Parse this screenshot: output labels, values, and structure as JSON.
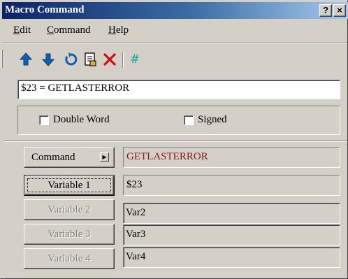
{
  "window": {
    "title": "Macro Command",
    "help_button": "?",
    "close_button": "×"
  },
  "menu": {
    "items": [
      {
        "label": "Edit",
        "mnemonic": "E",
        "rest": "dit"
      },
      {
        "label": "Command",
        "mnemonic": "C",
        "rest": "ommand"
      },
      {
        "label": "Help",
        "mnemonic": "H",
        "rest": "elp"
      }
    ]
  },
  "toolbar": {
    "icons": [
      "move-up-icon",
      "move-down-icon",
      "undo-icon",
      "properties-icon",
      "delete-icon",
      "number-icon"
    ],
    "hash_symbol": "#"
  },
  "colors": {
    "up_arrow": "#1060b0",
    "down_arrow": "#1060b0",
    "undo": "#1060b0",
    "delete": "#cc1010",
    "hash": "#10a0a0",
    "command_text": "#8b1a1a"
  },
  "expression": {
    "value": "$23 = GETLASTERROR"
  },
  "options": {
    "double_word": {
      "label": "Double Word",
      "checked": false
    },
    "signed": {
      "label": "Signed",
      "checked": false
    }
  },
  "command": {
    "button_label": "Command",
    "value": "GETLASTERROR"
  },
  "variables": [
    {
      "button_label": "Variable 1",
      "value": "$23",
      "enabled": true
    },
    {
      "button_label": "Variable 2",
      "value": "Var2",
      "enabled": false
    },
    {
      "button_label": "Variable 3",
      "value": "Var3",
      "enabled": false
    },
    {
      "button_label": "Variable 4",
      "value": "Var4",
      "enabled": false
    }
  ]
}
